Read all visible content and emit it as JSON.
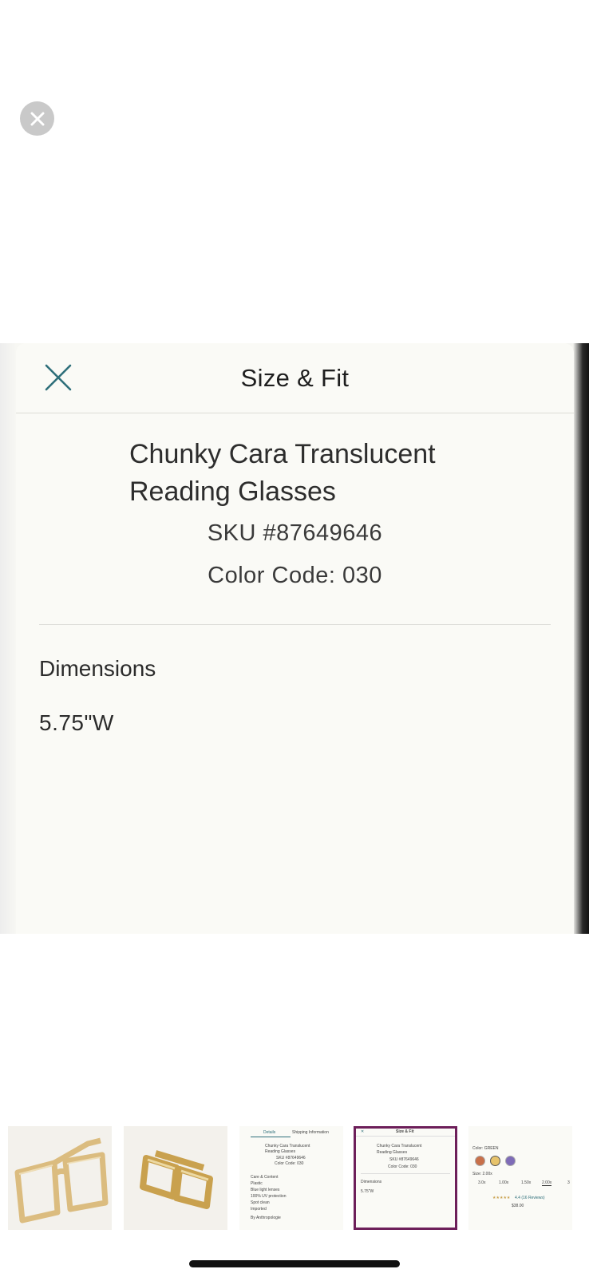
{
  "sheet": {
    "title": "Size & Fit",
    "product_name": "Chunky Cara Translucent Reading Glasses",
    "sku": "SKU #87649646",
    "color_code": "Color Code: 030",
    "dimensions_heading": "Dimensions",
    "dimensions_value": "5.75\"W"
  },
  "thumbnails": {
    "thumb3": {
      "tab_details": "Details",
      "tab_shipping": "Shipping Information",
      "name_line1": "Chunky Cara Translucent",
      "name_line2": "Reading Glasses",
      "sku": "SKU #87649646",
      "color_code": "Color Code: 030",
      "care_heading": "Care & Content",
      "care_items": [
        "Plastic",
        "Blue light lenses",
        "100% UV protection",
        "Spot clean",
        "Imported"
      ],
      "brand": "By Anthropologie"
    },
    "thumb4": {
      "title": "Size & Fit",
      "name_line1": "Chunky Cara Translucent",
      "name_line2": "Reading Glasses",
      "sku": "SKU #87649646",
      "color_code": "Color Code: 030",
      "dimensions_heading": "Dimensions",
      "dimensions_value": "5.75\"W"
    },
    "thumb5": {
      "color_label": "Color: GREEN",
      "size_label": "Size: 2.00x",
      "sizes": [
        "3.0x",
        "1.00x",
        "1.50x",
        "2.00x",
        "3"
      ],
      "stars": "★★★★★",
      "rating": "4.4 (16 Reviews)",
      "price": "$38.00"
    }
  },
  "colors": {
    "accent_teal": "#2e6f7a",
    "selected_border": "#6d1f5a"
  }
}
